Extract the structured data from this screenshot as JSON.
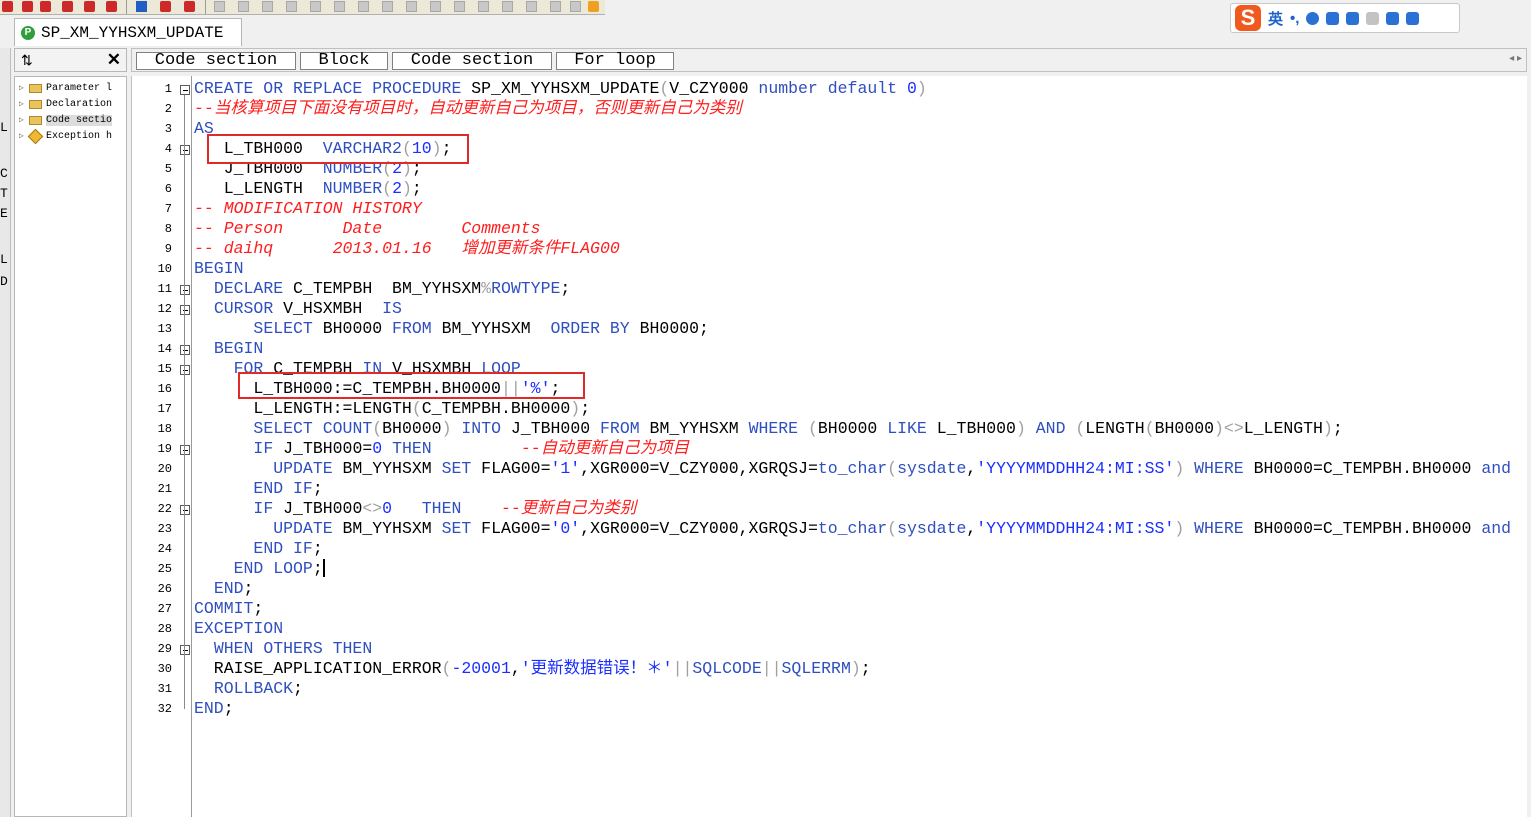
{
  "window": {
    "tab_title": "SP_XM_YYHSXM_UPDATE"
  },
  "ime": {
    "logo": "S",
    "mode_label": "英",
    "punct": "•,"
  },
  "left_strip": [
    "L",
    "C",
    "T",
    "E",
    "L",
    "D"
  ],
  "navigator": {
    "sort_icon": "sort-az-icon",
    "close_label": "✕",
    "items": [
      {
        "label": "Parameter l",
        "icon": "folder-icon"
      },
      {
        "label": "Declaration",
        "icon": "folder-icon"
      },
      {
        "label": "Code sectio",
        "icon": "folder-icon",
        "selected": true
      },
      {
        "label": "Exception h",
        "icon": "exception-icon"
      }
    ]
  },
  "breadcrumb": [
    {
      "label": "Code section"
    },
    {
      "label": "Block"
    },
    {
      "label": "Code section"
    },
    {
      "label": "For loop"
    }
  ],
  "editor": {
    "line_numbers": [
      "1",
      "2",
      "3",
      "4",
      "5",
      "6",
      "7",
      "8",
      "9",
      "10",
      "11",
      "12",
      "13",
      "14",
      "15",
      "16",
      "17",
      "18",
      "19",
      "20",
      "21",
      "22",
      "23",
      "24",
      "25",
      "26",
      "27",
      "28",
      "29",
      "30",
      "31",
      "32"
    ],
    "lines": [
      [
        [
          "kw",
          "CREATE OR REPLACE PROCEDURE "
        ],
        [
          "tx",
          "SP_XM_YYHSXM_UPDATE"
        ],
        [
          "op",
          "("
        ],
        [
          "tx",
          "V_CZY000 "
        ],
        [
          "kw",
          "number default "
        ],
        [
          "num",
          "0"
        ],
        [
          "op",
          ")"
        ]
      ],
      [
        [
          "cm",
          "--当核算项目下面没有项目时，自动更新自己为项目，否则更新自己为类别"
        ]
      ],
      [
        [
          "kw",
          "AS"
        ]
      ],
      [
        [
          "tx",
          "   L_TBH000  "
        ],
        [
          "kw",
          "VARCHAR2"
        ],
        [
          "op",
          "("
        ],
        [
          "num",
          "10"
        ],
        [
          "op",
          ")"
        ],
        [
          "tx",
          ";"
        ]
      ],
      [
        [
          "tx",
          "   J_TBH000  "
        ],
        [
          "kw",
          "NUMBER"
        ],
        [
          "op",
          "("
        ],
        [
          "num",
          "2"
        ],
        [
          "op",
          ")"
        ],
        [
          "tx",
          ";"
        ]
      ],
      [
        [
          "tx",
          "   L_LENGTH  "
        ],
        [
          "kw",
          "NUMBER"
        ],
        [
          "op",
          "("
        ],
        [
          "num",
          "2"
        ],
        [
          "op",
          ")"
        ],
        [
          "tx",
          ";"
        ]
      ],
      [
        [
          "cm",
          "-- MODIFICATION HISTORY"
        ]
      ],
      [
        [
          "cm",
          "-- Person      Date        Comments"
        ]
      ],
      [
        [
          "cm",
          "-- daihq      2013.01.16   增加更新条件FLAG00"
        ]
      ],
      [
        [
          "kw",
          "BEGIN"
        ]
      ],
      [
        [
          "tx",
          "  "
        ],
        [
          "kw",
          "DECLARE "
        ],
        [
          "tx",
          "C_TEMPBH  BM_YYHSXM"
        ],
        [
          "op",
          "%"
        ],
        [
          "kw",
          "ROWTYPE"
        ],
        [
          "tx",
          ";"
        ]
      ],
      [
        [
          "tx",
          "  "
        ],
        [
          "kw",
          "CURSOR "
        ],
        [
          "tx",
          "V_HSXMBH  "
        ],
        [
          "kw",
          "IS"
        ]
      ],
      [
        [
          "tx",
          "      "
        ],
        [
          "kw",
          "SELECT "
        ],
        [
          "tx",
          "BH0000 "
        ],
        [
          "kw",
          "FROM "
        ],
        [
          "tx",
          "BM_YYHSXM  "
        ],
        [
          "kw",
          "ORDER BY "
        ],
        [
          "tx",
          "BH0000;"
        ]
      ],
      [
        [
          "tx",
          "  "
        ],
        [
          "kw",
          "BEGIN"
        ]
      ],
      [
        [
          "tx",
          "    "
        ],
        [
          "kw",
          "FOR "
        ],
        [
          "tx",
          "C_TEMPBH "
        ],
        [
          "kw",
          "IN "
        ],
        [
          "tx",
          "V_HSXMBH "
        ],
        [
          "kw",
          "LOOP"
        ]
      ],
      [
        [
          "tx",
          "      L_TBH000:=C_TEMPBH.BH0000"
        ],
        [
          "op",
          "||"
        ],
        [
          "st",
          "'%'"
        ],
        [
          "tx",
          ";"
        ]
      ],
      [
        [
          "tx",
          "      L_LENGTH:=LENGTH"
        ],
        [
          "op",
          "("
        ],
        [
          "tx",
          "C_TEMPBH.BH0000"
        ],
        [
          "op",
          ")"
        ],
        [
          "tx",
          ";"
        ]
      ],
      [
        [
          "tx",
          "      "
        ],
        [
          "kw",
          "SELECT COUNT"
        ],
        [
          "op",
          "("
        ],
        [
          "tx",
          "BH0000"
        ],
        [
          "op",
          ") "
        ],
        [
          "kw",
          "INTO "
        ],
        [
          "tx",
          "J_TBH000 "
        ],
        [
          "kw",
          "FROM "
        ],
        [
          "tx",
          "BM_YYHSXM "
        ],
        [
          "kw",
          "WHERE "
        ],
        [
          "op",
          "("
        ],
        [
          "tx",
          "BH0000 "
        ],
        [
          "kw",
          "LIKE "
        ],
        [
          "tx",
          "L_TBH000"
        ],
        [
          "op",
          ") "
        ],
        [
          "kw",
          "AND "
        ],
        [
          "op",
          "("
        ],
        [
          "tx",
          "LENGTH"
        ],
        [
          "op",
          "("
        ],
        [
          "tx",
          "BH0000"
        ],
        [
          "op",
          ")<>"
        ],
        [
          "tx",
          "L_LENGTH"
        ],
        [
          "op",
          ")"
        ],
        [
          "tx",
          ";"
        ]
      ],
      [
        [
          "tx",
          "      "
        ],
        [
          "kw",
          "IF "
        ],
        [
          "tx",
          "J_TBH000="
        ],
        [
          "num",
          "0 "
        ],
        [
          "kw",
          "THEN"
        ],
        [
          "tx",
          "         "
        ],
        [
          "cm",
          "--自动更新自己为项目"
        ]
      ],
      [
        [
          "tx",
          "        "
        ],
        [
          "kw",
          "UPDATE "
        ],
        [
          "tx",
          "BM_YYHSXM "
        ],
        [
          "kw",
          "SET "
        ],
        [
          "tx",
          "FLAG00="
        ],
        [
          "st",
          "'1'"
        ],
        [
          "tx",
          ",XGR000=V_CZY000,XGRQSJ="
        ],
        [
          "kw",
          "to_char"
        ],
        [
          "op",
          "("
        ],
        [
          "kw",
          "sysdate"
        ],
        [
          "tx",
          ","
        ],
        [
          "st",
          "'YYYYMMDDHH24:MI:SS'"
        ],
        [
          "op",
          ") "
        ],
        [
          "kw",
          "WHERE "
        ],
        [
          "tx",
          "BH0000=C_TEMPBH.BH0000 "
        ],
        [
          "kw",
          "and"
        ]
      ],
      [
        [
          "tx",
          "      "
        ],
        [
          "kw",
          "END IF"
        ],
        [
          "tx",
          ";"
        ]
      ],
      [
        [
          "tx",
          "      "
        ],
        [
          "kw",
          "IF "
        ],
        [
          "tx",
          "J_TBH000"
        ],
        [
          "op",
          "<>"
        ],
        [
          "num",
          "0   "
        ],
        [
          "kw",
          "THEN"
        ],
        [
          "tx",
          "    "
        ],
        [
          "cm",
          "--更新自己为类别"
        ]
      ],
      [
        [
          "tx",
          "        "
        ],
        [
          "kw",
          "UPDATE "
        ],
        [
          "tx",
          "BM_YYHSXM "
        ],
        [
          "kw",
          "SET "
        ],
        [
          "tx",
          "FLAG00="
        ],
        [
          "st",
          "'0'"
        ],
        [
          "tx",
          ",XGR000=V_CZY000,XGRQSJ="
        ],
        [
          "kw",
          "to_char"
        ],
        [
          "op",
          "("
        ],
        [
          "kw",
          "sysdate"
        ],
        [
          "tx",
          ","
        ],
        [
          "st",
          "'YYYYMMDDHH24:MI:SS'"
        ],
        [
          "op",
          ") "
        ],
        [
          "kw",
          "WHERE "
        ],
        [
          "tx",
          "BH0000=C_TEMPBH.BH0000 "
        ],
        [
          "kw",
          "and"
        ]
      ],
      [
        [
          "tx",
          "      "
        ],
        [
          "kw",
          "END IF"
        ],
        [
          "tx",
          ";"
        ]
      ],
      [
        [
          "tx",
          "    "
        ],
        [
          "kw",
          "END LOOP"
        ],
        [
          "tx",
          ";"
        ]
      ],
      [
        [
          "tx",
          "  "
        ],
        [
          "kw",
          "END"
        ],
        [
          "tx",
          ";"
        ]
      ],
      [
        [
          "kw",
          "COMMIT"
        ],
        [
          "tx",
          ";"
        ]
      ],
      [
        [
          "kw",
          "EXCEPTION"
        ]
      ],
      [
        [
          "tx",
          "  "
        ],
        [
          "kw",
          "WHEN OTHERS THEN"
        ]
      ],
      [
        [
          "tx",
          "  RAISE_APPLICATION_ERROR"
        ],
        [
          "op",
          "("
        ],
        [
          "num",
          "-20001"
        ],
        [
          "tx",
          ","
        ],
        [
          "st",
          "'更新数据错误！＊'"
        ],
        [
          "op",
          "||"
        ],
        [
          "kw",
          "SQLCODE"
        ],
        [
          "op",
          "||"
        ],
        [
          "kw",
          "SQLERRM"
        ],
        [
          "op",
          ")"
        ],
        [
          "tx",
          ";"
        ]
      ],
      [
        [
          "tx",
          "  "
        ],
        [
          "kw",
          "ROLLBACK"
        ],
        [
          "tx",
          ";"
        ]
      ],
      [
        [
          "kw",
          "END"
        ],
        [
          "tx",
          ";"
        ]
      ]
    ]
  },
  "colors": {
    "keyword": "#2f4fbf",
    "comment": "#ff1d1d",
    "string": "#1a2fff",
    "highlight_box": "#e02a2a"
  }
}
